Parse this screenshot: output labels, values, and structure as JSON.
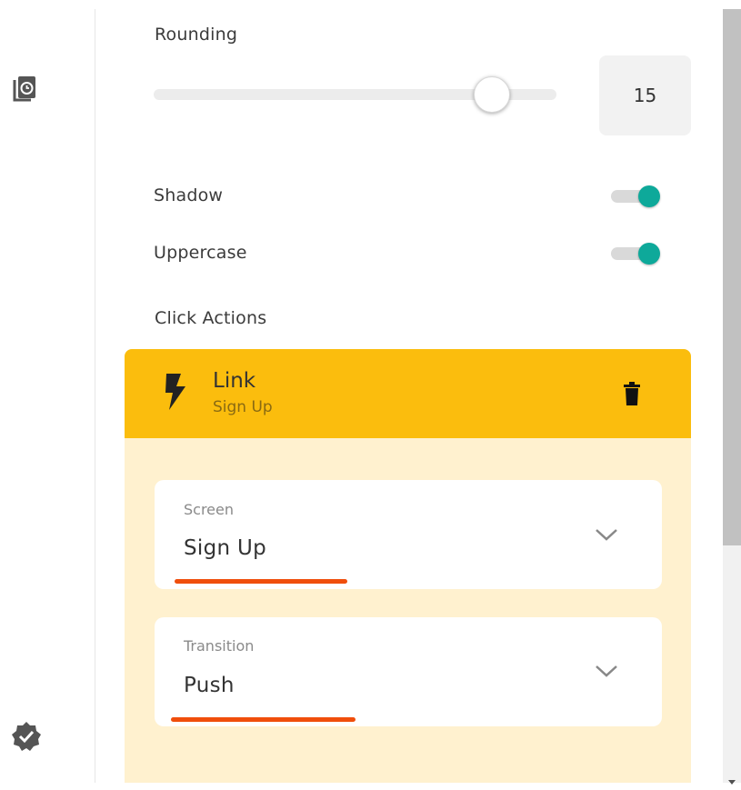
{
  "rail": {
    "top_icon": "page-clock-icon",
    "bottom_icon": "verified-check-icon"
  },
  "rounding": {
    "label": "Rounding",
    "slider_fraction": 0.84,
    "value": "15"
  },
  "toggles": {
    "shadow": {
      "label": "Shadow",
      "on": true
    },
    "uppercase": {
      "label": "Uppercase",
      "on": true
    }
  },
  "click_actions": {
    "label": "Click Actions",
    "action": {
      "icon": "lightning-bolt-icon",
      "title": "Link",
      "subtitle": "Sign Up",
      "delete_icon": "trash-icon"
    },
    "screen": {
      "label": "Screen",
      "value": "Sign Up"
    },
    "transition": {
      "label": "Transition",
      "value": "Push"
    }
  },
  "colors": {
    "accent_teal": "#0ea99a",
    "card_header": "#fbbd0d",
    "card_body": "#fff1cf",
    "underline": "#f04e0c"
  }
}
